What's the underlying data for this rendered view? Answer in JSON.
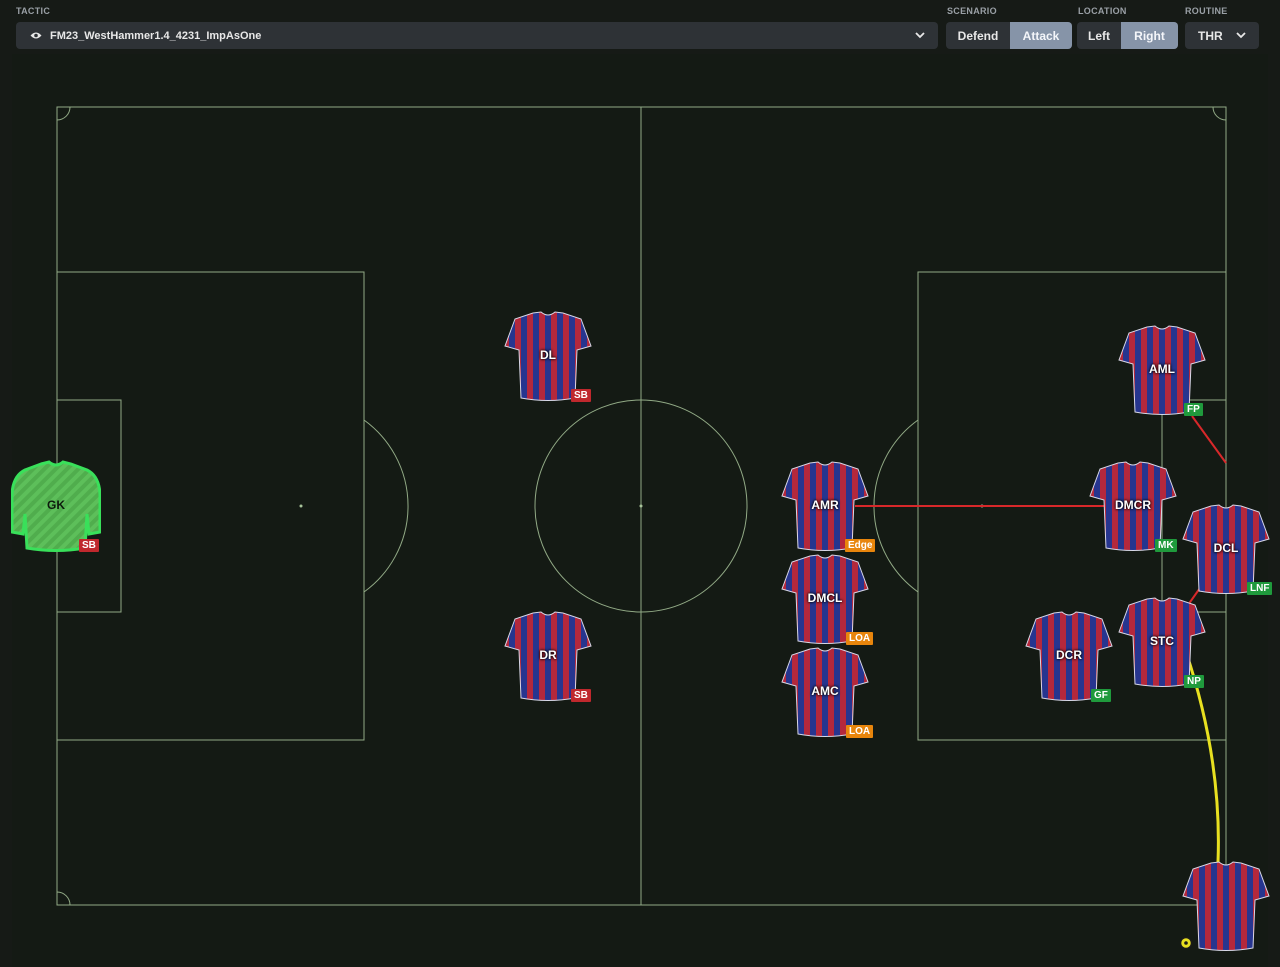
{
  "header": {
    "tactic_label": "TACTIC",
    "tactic_name": "FM23_WestHammer1.4_4231_ImpAsOne",
    "scenario_label": "SCENARIO",
    "scenario_options": [
      "Defend",
      "Attack"
    ],
    "scenario_selected": "Attack",
    "location_label": "LOCATION",
    "location_options": [
      "Left",
      "Right"
    ],
    "location_selected": "Right",
    "routine_label": "ROUTINE",
    "routine_value": "THR"
  },
  "colors": {
    "pitch": "#141a14",
    "pitch_lines": "#a8c49a",
    "kit_red": "#b4283c",
    "kit_blue": "#27358f",
    "gk_kit": "#5dbf5a",
    "gk_outline": "#39e05a",
    "run_line": "#d8282a",
    "ball_path": "#e8e020"
  },
  "players": [
    {
      "id": "gk",
      "position": "GK",
      "tag": "SB",
      "tag_color": "red"
    },
    {
      "id": "dl",
      "position": "DL",
      "tag": "SB",
      "tag_color": "red"
    },
    {
      "id": "dr",
      "position": "DR",
      "tag": "SB",
      "tag_color": "red"
    },
    {
      "id": "amr",
      "position": "AMR",
      "tag": "Edge",
      "tag_color": "orange"
    },
    {
      "id": "dmcl",
      "position": "DMCL",
      "tag": "LOA",
      "tag_color": "orange"
    },
    {
      "id": "amc",
      "position": "AMC",
      "tag": "LOA",
      "tag_color": "orange"
    },
    {
      "id": "aml",
      "position": "AML",
      "tag": "FP",
      "tag_color": "green"
    },
    {
      "id": "dmcr",
      "position": "DMCR",
      "tag": "MK",
      "tag_color": "green"
    },
    {
      "id": "dcl",
      "position": "DCL",
      "tag": "LNF",
      "tag_color": "green"
    },
    {
      "id": "dcr",
      "position": "DCR",
      "tag": "GF",
      "tag_color": "green"
    },
    {
      "id": "stc",
      "position": "STC",
      "tag": "NP",
      "tag_color": "green"
    },
    {
      "id": "taker",
      "position": "",
      "tag": "",
      "tag_color": ""
    }
  ],
  "ball_icon": "football-icon"
}
